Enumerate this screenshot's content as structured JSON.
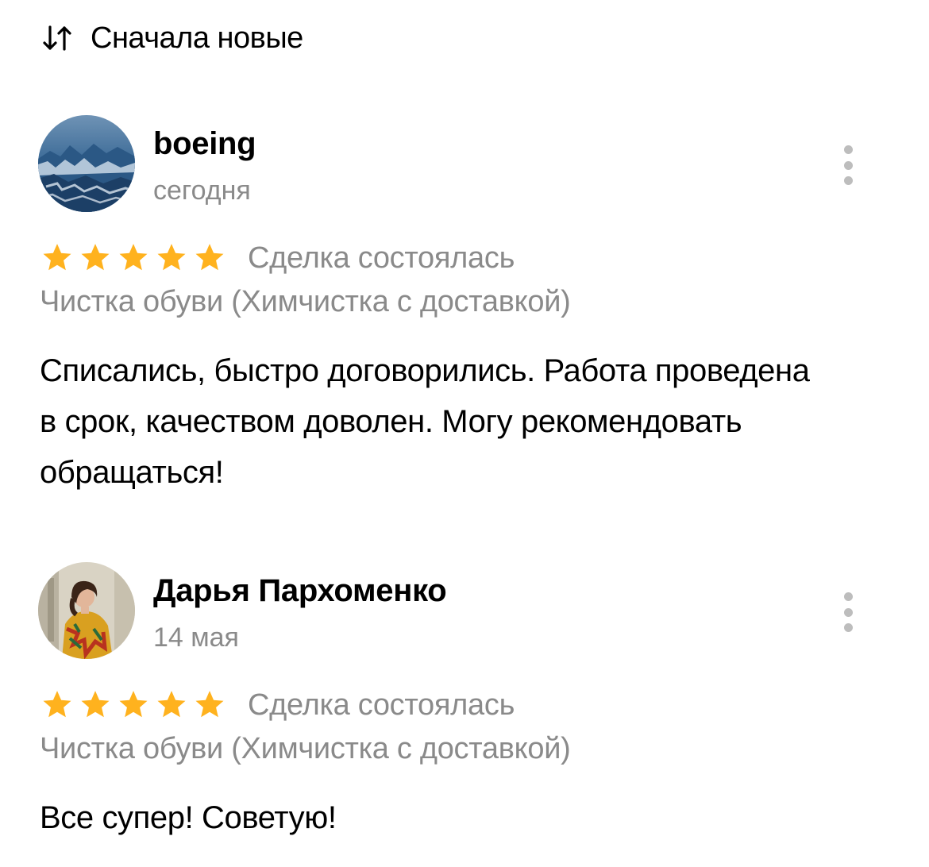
{
  "sort": {
    "label": "Сначала новые",
    "icon": "sort-arrows-icon"
  },
  "reviews": [
    {
      "author": "boeing",
      "date": "сегодня",
      "avatar": "mountains-photo",
      "rating": 5,
      "deal_status": "Сделка состоялась",
      "service": "Чистка обуви (Химчистка с доставкой)",
      "text": "Списались, быстро договорились. Работа проведена в срок, качеством доволен. Могу рекомендовать обращаться!"
    },
    {
      "author": "Дарья Пархоменко",
      "date": "14 мая",
      "avatar": "person-photo",
      "rating": 5,
      "deal_status": "Сделка состоялась",
      "service": "Чистка обуви (Химчистка с доставкой)",
      "text": "Все супер! Советую!"
    }
  ],
  "colors": {
    "star": "#FFB21E",
    "secondary_text": "#8A8A8A",
    "more_dots": "#BDBDBD"
  }
}
